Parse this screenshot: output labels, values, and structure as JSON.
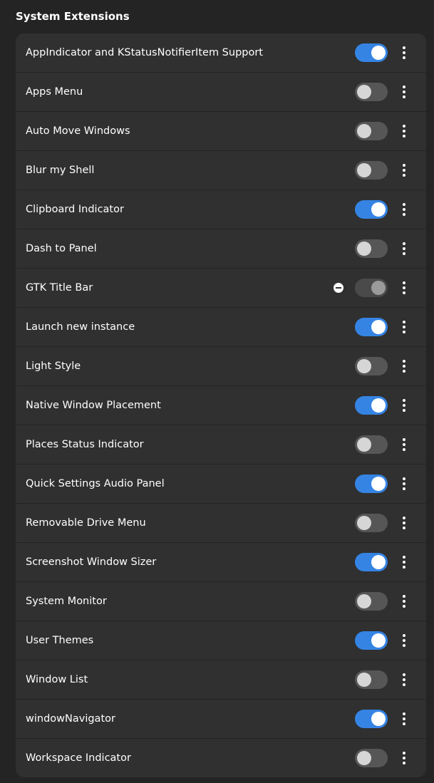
{
  "section": {
    "title": "System Extensions"
  },
  "colors": {
    "accent": "#3584e4",
    "background": "#242424",
    "card": "#303030"
  },
  "extensions": [
    {
      "name": "AppIndicator and KStatusNotifierItem Support",
      "enabled": true
    },
    {
      "name": "Apps Menu",
      "enabled": false
    },
    {
      "name": "Auto Move Windows",
      "enabled": false
    },
    {
      "name": "Blur my Shell",
      "enabled": false
    },
    {
      "name": "Clipboard Indicator",
      "enabled": true
    },
    {
      "name": "Dash to Panel",
      "enabled": false
    },
    {
      "name": "GTK Title Bar",
      "enabled": true,
      "error": true,
      "switch_disabled": true
    },
    {
      "name": "Launch new instance",
      "enabled": true
    },
    {
      "name": "Light Style",
      "enabled": false
    },
    {
      "name": "Native Window Placement",
      "enabled": true
    },
    {
      "name": "Places Status Indicator",
      "enabled": false
    },
    {
      "name": "Quick Settings Audio Panel",
      "enabled": true
    },
    {
      "name": "Removable Drive Menu",
      "enabled": false
    },
    {
      "name": "Screenshot Window Sizer",
      "enabled": true
    },
    {
      "name": "System Monitor",
      "enabled": false
    },
    {
      "name": "User Themes",
      "enabled": true
    },
    {
      "name": "Window List",
      "enabled": false
    },
    {
      "name": "windowNavigator",
      "enabled": true
    },
    {
      "name": "Workspace Indicator",
      "enabled": false
    }
  ]
}
